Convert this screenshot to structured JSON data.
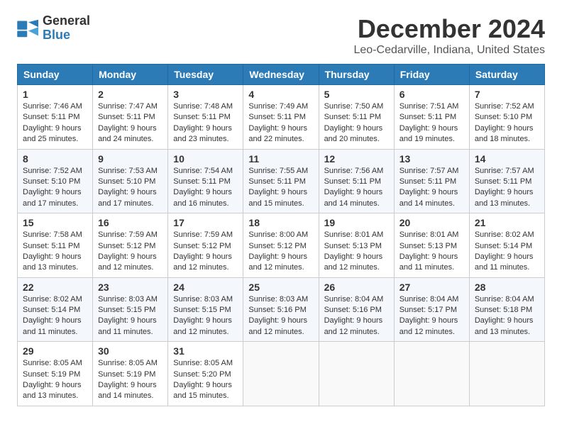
{
  "logo": {
    "line1": "General",
    "line2": "Blue"
  },
  "title": "December 2024",
  "location": "Leo-Cedarville, Indiana, United States",
  "headers": [
    "Sunday",
    "Monday",
    "Tuesday",
    "Wednesday",
    "Thursday",
    "Friday",
    "Saturday"
  ],
  "weeks": [
    [
      {
        "day": "1",
        "sunrise": "7:46 AM",
        "sunset": "5:11 PM",
        "daylight": "9 hours and 25 minutes."
      },
      {
        "day": "2",
        "sunrise": "7:47 AM",
        "sunset": "5:11 PM",
        "daylight": "9 hours and 24 minutes."
      },
      {
        "day": "3",
        "sunrise": "7:48 AM",
        "sunset": "5:11 PM",
        "daylight": "9 hours and 23 minutes."
      },
      {
        "day": "4",
        "sunrise": "7:49 AM",
        "sunset": "5:11 PM",
        "daylight": "9 hours and 22 minutes."
      },
      {
        "day": "5",
        "sunrise": "7:50 AM",
        "sunset": "5:11 PM",
        "daylight": "9 hours and 20 minutes."
      },
      {
        "day": "6",
        "sunrise": "7:51 AM",
        "sunset": "5:11 PM",
        "daylight": "9 hours and 19 minutes."
      },
      {
        "day": "7",
        "sunrise": "7:52 AM",
        "sunset": "5:10 PM",
        "daylight": "9 hours and 18 minutes."
      }
    ],
    [
      {
        "day": "8",
        "sunrise": "7:52 AM",
        "sunset": "5:10 PM",
        "daylight": "9 hours and 17 minutes."
      },
      {
        "day": "9",
        "sunrise": "7:53 AM",
        "sunset": "5:10 PM",
        "daylight": "9 hours and 17 minutes."
      },
      {
        "day": "10",
        "sunrise": "7:54 AM",
        "sunset": "5:11 PM",
        "daylight": "9 hours and 16 minutes."
      },
      {
        "day": "11",
        "sunrise": "7:55 AM",
        "sunset": "5:11 PM",
        "daylight": "9 hours and 15 minutes."
      },
      {
        "day": "12",
        "sunrise": "7:56 AM",
        "sunset": "5:11 PM",
        "daylight": "9 hours and 14 minutes."
      },
      {
        "day": "13",
        "sunrise": "7:57 AM",
        "sunset": "5:11 PM",
        "daylight": "9 hours and 14 minutes."
      },
      {
        "day": "14",
        "sunrise": "7:57 AM",
        "sunset": "5:11 PM",
        "daylight": "9 hours and 13 minutes."
      }
    ],
    [
      {
        "day": "15",
        "sunrise": "7:58 AM",
        "sunset": "5:11 PM",
        "daylight": "9 hours and 13 minutes."
      },
      {
        "day": "16",
        "sunrise": "7:59 AM",
        "sunset": "5:12 PM",
        "daylight": "9 hours and 12 minutes."
      },
      {
        "day": "17",
        "sunrise": "7:59 AM",
        "sunset": "5:12 PM",
        "daylight": "9 hours and 12 minutes."
      },
      {
        "day": "18",
        "sunrise": "8:00 AM",
        "sunset": "5:12 PM",
        "daylight": "9 hours and 12 minutes."
      },
      {
        "day": "19",
        "sunrise": "8:01 AM",
        "sunset": "5:13 PM",
        "daylight": "9 hours and 12 minutes."
      },
      {
        "day": "20",
        "sunrise": "8:01 AM",
        "sunset": "5:13 PM",
        "daylight": "9 hours and 11 minutes."
      },
      {
        "day": "21",
        "sunrise": "8:02 AM",
        "sunset": "5:14 PM",
        "daylight": "9 hours and 11 minutes."
      }
    ],
    [
      {
        "day": "22",
        "sunrise": "8:02 AM",
        "sunset": "5:14 PM",
        "daylight": "9 hours and 11 minutes."
      },
      {
        "day": "23",
        "sunrise": "8:03 AM",
        "sunset": "5:15 PM",
        "daylight": "9 hours and 11 minutes."
      },
      {
        "day": "24",
        "sunrise": "8:03 AM",
        "sunset": "5:15 PM",
        "daylight": "9 hours and 12 minutes."
      },
      {
        "day": "25",
        "sunrise": "8:03 AM",
        "sunset": "5:16 PM",
        "daylight": "9 hours and 12 minutes."
      },
      {
        "day": "26",
        "sunrise": "8:04 AM",
        "sunset": "5:16 PM",
        "daylight": "9 hours and 12 minutes."
      },
      {
        "day": "27",
        "sunrise": "8:04 AM",
        "sunset": "5:17 PM",
        "daylight": "9 hours and 12 minutes."
      },
      {
        "day": "28",
        "sunrise": "8:04 AM",
        "sunset": "5:18 PM",
        "daylight": "9 hours and 13 minutes."
      }
    ],
    [
      {
        "day": "29",
        "sunrise": "8:05 AM",
        "sunset": "5:19 PM",
        "daylight": "9 hours and 13 minutes."
      },
      {
        "day": "30",
        "sunrise": "8:05 AM",
        "sunset": "5:19 PM",
        "daylight": "9 hours and 14 minutes."
      },
      {
        "day": "31",
        "sunrise": "8:05 AM",
        "sunset": "5:20 PM",
        "daylight": "9 hours and 15 minutes."
      },
      null,
      null,
      null,
      null
    ]
  ],
  "labels": {
    "sunrise": "Sunrise:",
    "sunset": "Sunset:",
    "daylight": "Daylight:"
  }
}
